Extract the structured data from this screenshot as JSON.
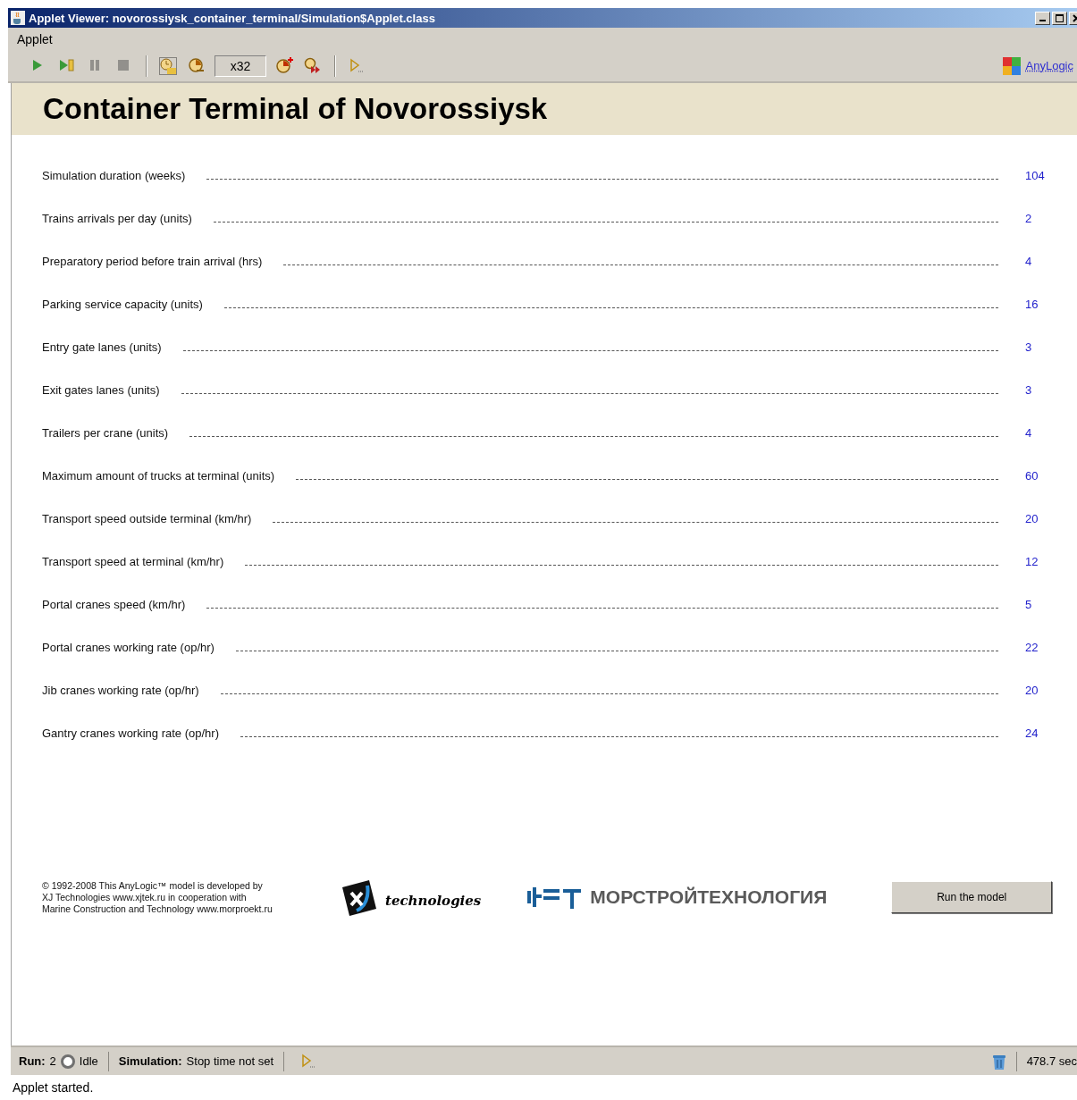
{
  "window": {
    "title": "Applet Viewer: novorossiysk_container_terminal/Simulation$Applet.class"
  },
  "menu": [
    "Applet"
  ],
  "toolbar": [
    {
      "kind": "run",
      "disabled": false
    },
    {
      "kind": "step",
      "disabled": false
    },
    {
      "kind": "pause",
      "disabled": true
    },
    {
      "kind": "stop",
      "disabled": true
    },
    {
      "kind": "sep"
    },
    {
      "kind": "realtime",
      "disabled": false
    },
    {
      "kind": "slower",
      "disabled": false
    },
    {
      "kind": "speed",
      "value": "x32"
    },
    {
      "kind": "faster",
      "disabled": false
    },
    {
      "kind": "virtual",
      "disabled": false
    },
    {
      "kind": "sep"
    },
    {
      "kind": "more",
      "disabled": false
    }
  ],
  "brand_link": "AnyLogic",
  "header": {
    "title": "Container Terminal of Novorossiysk"
  },
  "parameters": [
    {
      "label": "Simulation duration (weeks)",
      "value": "104"
    },
    {
      "label": "Trains arrivals per day (units)",
      "value": "2"
    },
    {
      "label": "Preparatory period before train arrival (hrs)",
      "value": "4"
    },
    {
      "label": "Parking service capacity (units)",
      "value": "16"
    },
    {
      "label": "Entry gate lanes (units)",
      "value": "3"
    },
    {
      "label": "Exit gates lanes (units)",
      "value": "3"
    },
    {
      "label": "Trailers per crane (units)",
      "value": "4"
    },
    {
      "label": "Maximum amount of trucks at terminal (units)",
      "value": "60"
    },
    {
      "label": "Transport speed outside terminal (km/hr)",
      "value": "20"
    },
    {
      "label": "Transport speed at terminal (km/hr)",
      "value": "12"
    },
    {
      "label": "Portal cranes speed (km/hr)",
      "value": "5"
    },
    {
      "label": "Portal cranes working rate (op/hr)",
      "value": "22"
    },
    {
      "label": "Jib cranes working rate (op/hr)",
      "value": "20"
    },
    {
      "label": "Gantry cranes working rate (op/hr)",
      "value": "24"
    }
  ],
  "footer": {
    "credits": [
      "© 1992-2008 This AnyLogic™ model is developed by",
      "XJ Technologies www.xjtek.ru in cooperation with",
      "Marine Construction and Technology www.morproekt.ru"
    ],
    "xj_logo_text": "technologies",
    "mct_logo_text": "МОРСТРОЙТЕХНОЛОГИЯ",
    "run_button": "Run the model"
  },
  "status_bar": {
    "run_label": "Run:",
    "run_number": "2",
    "run_state": "Idle",
    "sim_label": "Simulation:",
    "sim_state": "Stop time not set",
    "elapsed": "478.7 sec"
  },
  "applet_status": "Applet started."
}
